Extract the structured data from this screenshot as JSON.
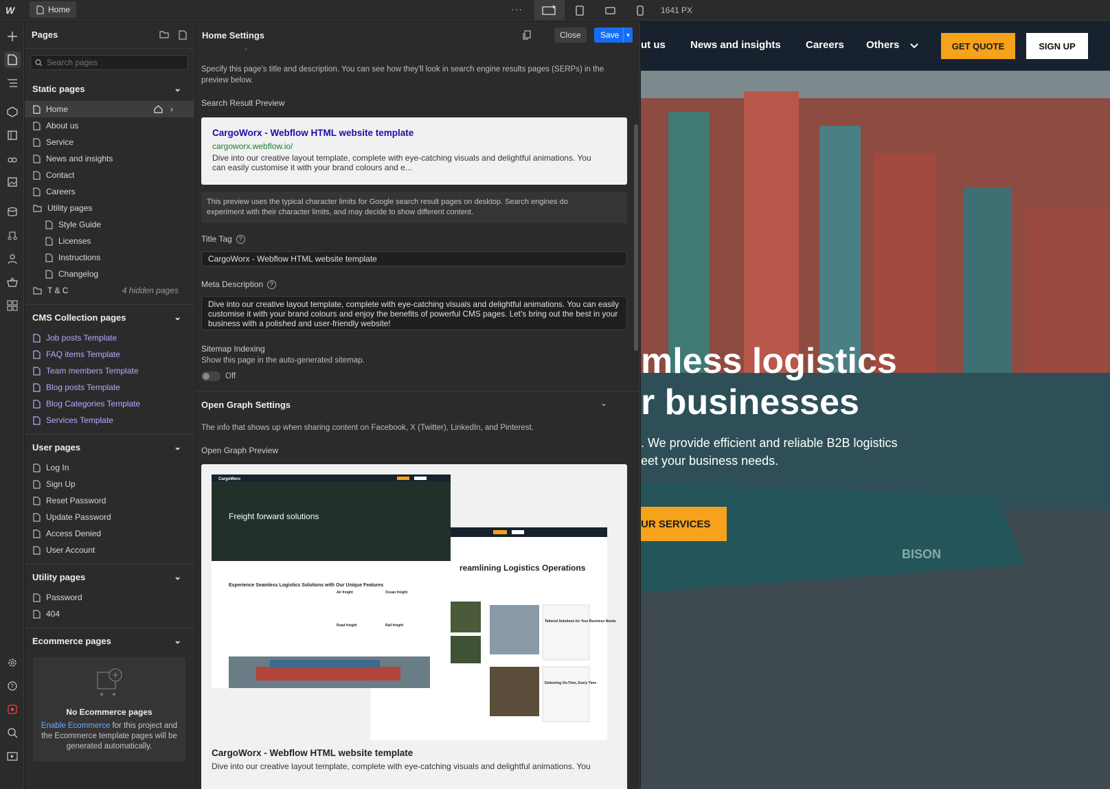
{
  "topbar": {
    "home_tab": "Home",
    "more": "···",
    "width_readout": "1641 PX"
  },
  "pages_panel": {
    "title": "Pages",
    "search_placeholder": "Search pages",
    "static": {
      "title": "Static pages",
      "items": [
        "Home",
        "About us",
        "Service",
        "News and insights",
        "Contact",
        "Careers",
        "Utility pages"
      ],
      "utility_children": [
        "Style Guide",
        "Licenses",
        "Instructions",
        "Changelog"
      ],
      "tc": "T & C",
      "tc_hidden": "4 hidden pages"
    },
    "cms": {
      "title": "CMS Collection pages",
      "items": [
        "Job posts Template",
        "FAQ items Template",
        "Team members Template",
        "Blog posts Template",
        "Blog Categories Template",
        "Services Template"
      ]
    },
    "user": {
      "title": "User pages",
      "items": [
        "Log In",
        "Sign Up",
        "Reset Password",
        "Update Password",
        "Access Denied",
        "User Account"
      ]
    },
    "utility": {
      "title": "Utility pages",
      "items": [
        "Password",
        "404"
      ]
    },
    "ecommerce": {
      "title": "Ecommerce pages",
      "empty_title": "No Ecommerce pages",
      "link": "Enable Ecommerce",
      "text1": " for this project and",
      "text2": "the Ecommerce template pages will be",
      "text3": "generated automatically."
    }
  },
  "settings": {
    "title": "Home Settings",
    "close": "Close",
    "save": "Save",
    "seo_heading_cut": "SEO Settings",
    "seo_desc1": "Specify this page's title and description. You can see how they'll look in search engine results pages (SERPs) in the",
    "seo_desc2": "preview below.",
    "serp_label": "Search Result Preview",
    "serp": {
      "title": "CargoWorx - Webflow HTML website template",
      "url": "cargoworx.webflow.io/",
      "desc1": "Dive into our creative layout template, complete with eye-catching visuals and delightful animations. You",
      "desc2": "can easily customise it with your brand colours and e..."
    },
    "note1": "This preview uses the typical character limits for Google search result pages on desktop. Search engines do",
    "note2": "experiment with their character limits, and may decide to show different content.",
    "title_tag_label": "Title Tag",
    "title_tag_value": "CargoWorx - Webflow HTML website template",
    "meta_label": "Meta Description",
    "meta_value": "Dive into our creative layout template, complete with eye-catching visuals and delightful animations. You can easily customise it with your brand colours and enjoy the benefits of powerful CMS pages. Let's bring out the best in your business with a polished and user-friendly website!",
    "sitemap_label": "Sitemap Indexing",
    "sitemap_desc": "Show this page in the auto-generated sitemap.",
    "sitemap_state": "Off",
    "og_heading": "Open Graph Settings",
    "og_desc": "The info that shows up when sharing content on Facebook, X (Twitter), LinkedIn, and Pinterest.",
    "og_label": "Open Graph Preview",
    "og_image": {
      "hero": "Freight forward solutions",
      "section": "Experience Seamless Logistics Solutions with Our Unique Features",
      "heading2": "reamlining Logistics Operations",
      "features": [
        "Air freight",
        "Ocean freight",
        "Road freight",
        "Rail freight"
      ],
      "cards": [
        "Tailored Solutions for Your Business Needs",
        "Delivering On-Time, Every Time"
      ],
      "logo": "CargoWorx"
    },
    "og_title": "CargoWorx - Webflow HTML website template",
    "og_desc_text": "Dive into our creative layout template, complete with eye-catching visuals and delightful animations. You"
  },
  "canvas": {
    "nav": [
      "ut us",
      "News and insights",
      "Careers",
      "Others"
    ],
    "quote": "GET QUOTE",
    "signup": "SIGN UP",
    "hero1": "mless logistics",
    "hero2": "r businesses",
    "sub1": ". We provide efficient and reliable B2B logistics",
    "sub2": "eet your business needs.",
    "services": "UR SERVICES",
    "ship_name": "BISON"
  },
  "colors": {
    "accent": "#146ef5",
    "brand_orange": "#f6a21a",
    "cms_link": "#b8a8ff",
    "nav_bg": "#17222e"
  }
}
